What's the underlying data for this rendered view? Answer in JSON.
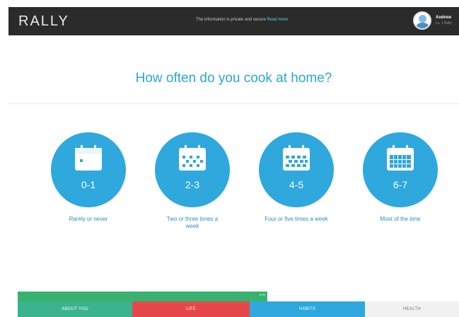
{
  "header": {
    "logo_text": "RALLY",
    "secure_message": "The information is private and secure",
    "secure_link": "Read more",
    "user_name": "Andrew",
    "user_sub": "Lv. 1 Rally"
  },
  "question": "How often do you cook at home?",
  "options": [
    {
      "range": "0-1",
      "label": "Rarely or never"
    },
    {
      "range": "2-3",
      "label": "Two or three times a week"
    },
    {
      "range": "4-5",
      "label": "Four or five times a week"
    },
    {
      "range": "6-7",
      "label": "Most of the time"
    }
  ],
  "progress": {
    "fraction": 0.57,
    "marker_text": "57%"
  },
  "tabs": [
    {
      "label": "ABOUT YOU",
      "color": "#3bb38f"
    },
    {
      "label": "LIFE",
      "color": "#e6474b"
    },
    {
      "label": "HABITS",
      "color": "#2ea8dd"
    },
    {
      "label": "HEALTH",
      "color": "#f1f1f1"
    }
  ],
  "colors": {
    "accent": "#2ea8dd",
    "header_bg": "#2b2b2b",
    "progress": "#38b26f"
  }
}
